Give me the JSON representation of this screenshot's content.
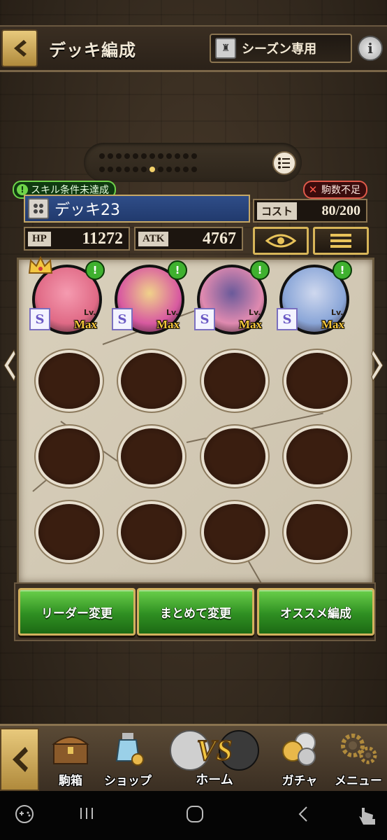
{
  "header": {
    "title": "デッキ編成",
    "season_label": "シーズン専用",
    "info_label": "i"
  },
  "pager": {
    "total_rows": [
      12,
      12
    ],
    "active_index": 4
  },
  "status": {
    "skill_warning": "スキル条件未達成",
    "unit_warning": "駒数不足"
  },
  "deck": {
    "name": "デッキ23",
    "cost_label": "コスト",
    "cost_value": "80/200",
    "hp_label": "HP",
    "hp_value": "11272",
    "atk_label": "ATK",
    "atk_value": "4767"
  },
  "characters": [
    {
      "rank": "S",
      "lv_label": "Lv.",
      "level": "Max",
      "leader": true,
      "colors": [
        "#f59bb0",
        "#e06a86"
      ]
    },
    {
      "rank": "S",
      "lv_label": "Lv.",
      "level": "Max",
      "leader": false,
      "colors": [
        "#f0d28a",
        "#d85aa0"
      ]
    },
    {
      "rank": "S",
      "lv_label": "Lv.",
      "level": "Max",
      "leader": false,
      "colors": [
        "#6a5a9a",
        "#e08ab0"
      ]
    },
    {
      "rank": "S",
      "lv_label": "Lv.",
      "level": "Max",
      "leader": false,
      "colors": [
        "#cfd8ee",
        "#8aa6d8"
      ]
    }
  ],
  "actions": {
    "leader_change": "リーダー変更",
    "bulk_change": "まとめて変更",
    "recommended": "オススメ編成"
  },
  "nav": {
    "box": "駒箱",
    "shop": "ショップ",
    "home": "ホーム",
    "gacha": "ガチャ",
    "menu": "メニュー",
    "vs_label": "VS"
  },
  "colors": {
    "accent_gold": "#d7b559",
    "deck_blue": "#2f4d88",
    "button_green": "#2f8f22"
  }
}
